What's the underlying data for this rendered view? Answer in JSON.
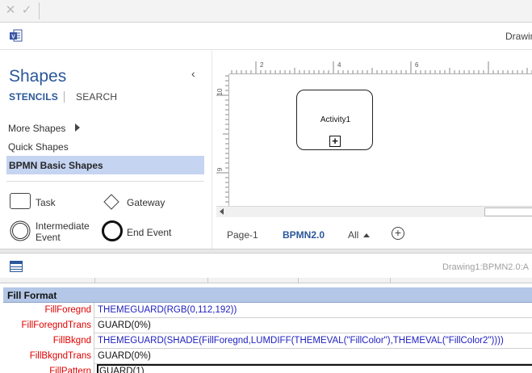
{
  "formula_bar": {
    "cancel_icon": "x-icon",
    "enter_icon": "check-icon"
  },
  "title_bar": {
    "app_icon": "visio-logo-icon",
    "title": "Drawin"
  },
  "shapes_pane": {
    "title": "Shapes",
    "collapse_icon": "chevron-left-icon",
    "tabs": {
      "stencils": "STENCILS",
      "search": "SEARCH"
    },
    "more_shapes": "More Shapes",
    "quick_shapes": "Quick Shapes",
    "selected_stencil": "BPMN Basic Shapes",
    "stencil_items": [
      {
        "label": "Task",
        "icon": "rounded-rectangle-icon"
      },
      {
        "label": "Gateway",
        "icon": "diamond-icon"
      },
      {
        "label": "Intermediate Event",
        "line1": "Intermediate",
        "line2": "Event",
        "icon": "double-circle-icon"
      },
      {
        "label": "End Event",
        "icon": "thick-circle-icon"
      }
    ]
  },
  "ruler": {
    "h_labels": [
      "2",
      "4",
      "6"
    ],
    "v_labels": [
      "10",
      "9"
    ]
  },
  "canvas": {
    "activity_label": "Activity1",
    "expand_marker": "+"
  },
  "page_tabs": {
    "page1": "Page-1",
    "bpmn": "BPMN2.0",
    "all": "All",
    "add_icon": "plus-circle-icon"
  },
  "shapesheet": {
    "icon": "shapesheet-icon",
    "path": "Drawing1:BPMN2.0:A",
    "section": "Fill Format",
    "rows": [
      {
        "name": "FillForegnd",
        "formula": "THEMEGUARD(RGB(0,112,192))",
        "style": "blue"
      },
      {
        "name": "FillForegndTrans",
        "formula": "GUARD(0%)",
        "style": "dark"
      },
      {
        "name": "FillBkgnd",
        "formula": "THEMEGUARD(SHADE(FillForegnd,LUMDIFF(THEMEVAL(\"FillColor\"),THEMEVAL(\"FillColor2\"))))",
        "style": "blue"
      },
      {
        "name": "FillBkgndTrans",
        "formula": "GUARD(0%)",
        "style": "dark"
      },
      {
        "name": "FillPattern",
        "formula": "GUARD(1)",
        "style": "dark"
      }
    ]
  }
}
